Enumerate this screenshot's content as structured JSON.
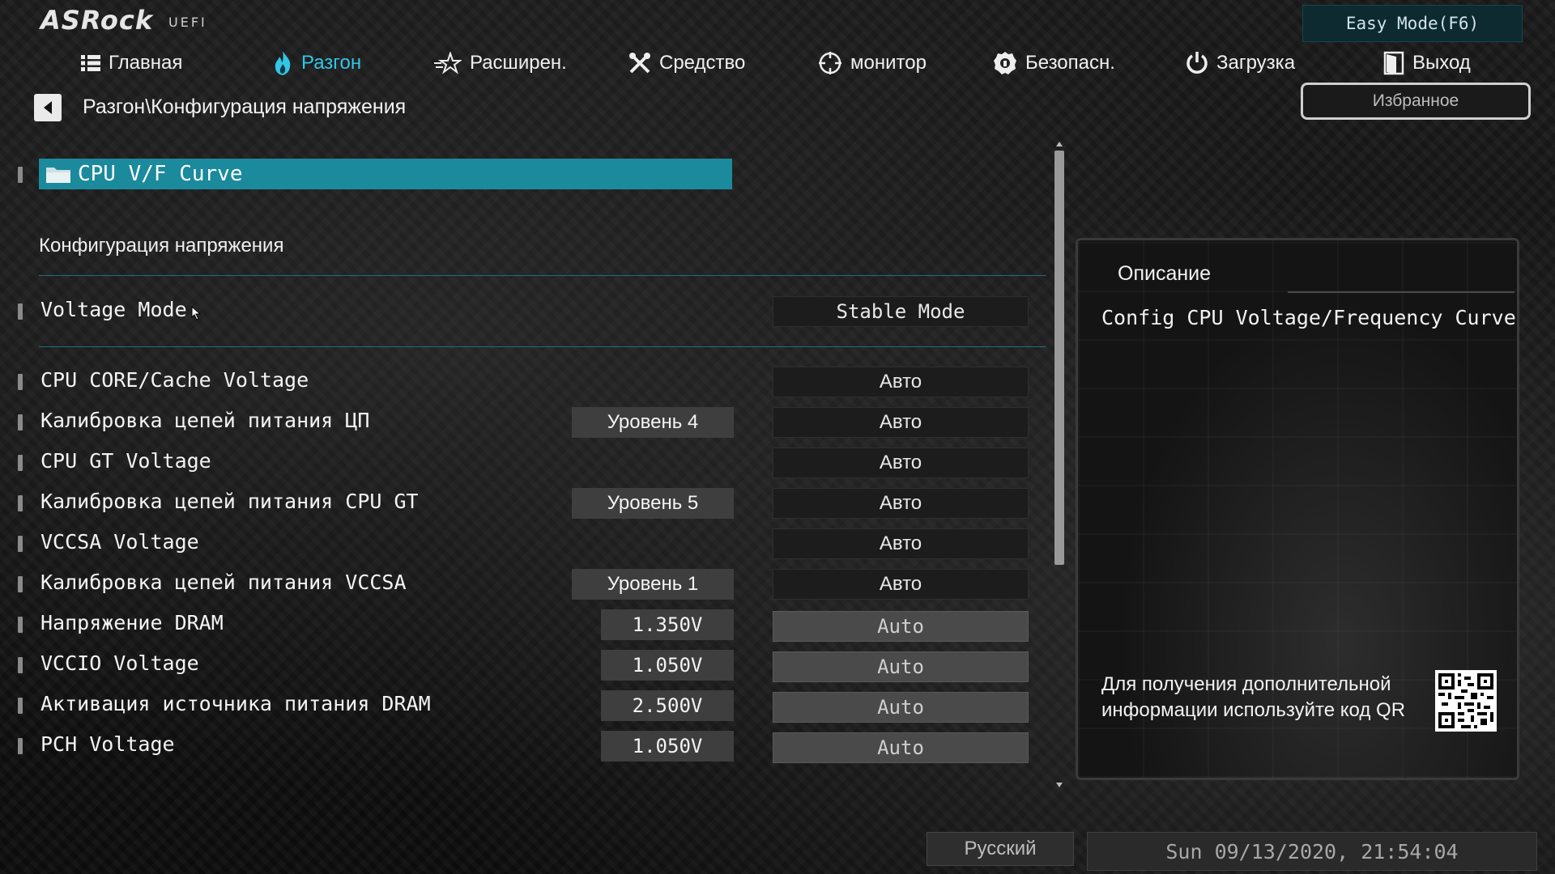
{
  "header": {
    "brand": "ASRock",
    "brand_sub": "UEFI",
    "easy_mode_label": "Easy Mode(F6)",
    "favorites_label": "Избранное"
  },
  "nav": {
    "active": "Разгон",
    "tabs": [
      {
        "label": "Главная",
        "icon": "list-icon"
      },
      {
        "label": "Разгон",
        "icon": "flame-icon"
      },
      {
        "label": "Расширен.",
        "icon": "star-icon"
      },
      {
        "label": "Средство",
        "icon": "tools-icon"
      },
      {
        "label": "монитор",
        "icon": "target-icon"
      },
      {
        "label": "Безопасн.",
        "icon": "shield-icon"
      },
      {
        "label": "Загрузка",
        "icon": "power-icon"
      },
      {
        "label": "Выход",
        "icon": "exit-door-icon"
      }
    ]
  },
  "breadcrumb": "Разгон\\Конфигурация напряжения",
  "main": {
    "folder_item": "CPU V/F Curve",
    "section_title": "Конфигурация напряжения",
    "voltage_mode": {
      "label": "Voltage Mode",
      "value": "Stable Mode"
    },
    "rows": [
      {
        "label": "CPU CORE/Cache Voltage",
        "mid": "",
        "value": "Авто",
        "style": "dark"
      },
      {
        "label": "Калибровка цепей питания ЦП",
        "mid": "Уровень 4",
        "value": "Авто",
        "style": "dark"
      },
      {
        "label": "CPU GT Voltage",
        "mid": "",
        "value": "Авто",
        "style": "dark"
      },
      {
        "label": "Калибровка цепей питания CPU GT",
        "mid": "Уровень 5",
        "value": "Авто",
        "style": "dark"
      },
      {
        "label": "VCCSA Voltage",
        "mid": "",
        "value": "Авто",
        "style": "dark"
      },
      {
        "label": "Калибровка цепей питания VCCSA",
        "mid": "Уровень 1",
        "value": "Авто",
        "style": "dark"
      },
      {
        "label": "Напряжение DRAM",
        "mid": "1.350V",
        "value": "Auto",
        "style": "gray"
      },
      {
        "label": "VCCIO Voltage",
        "mid": "1.050V",
        "value": "Auto",
        "style": "gray"
      },
      {
        "label": "Активация источника питания DRAM",
        "mid": "2.500V",
        "value": "Auto",
        "style": "gray"
      },
      {
        "label": "PCH Voltage",
        "mid": "1.050V",
        "value": "Auto",
        "style": "gray"
      }
    ]
  },
  "description": {
    "title": "Описание",
    "text": "Config CPU Voltage/Frequency Curve",
    "qr_note": "Для получения дополнительной информации используйте код QR"
  },
  "footer": {
    "language": "Русский",
    "datetime": "Sun 09/13/2020, 21:54:04"
  },
  "colors": {
    "accent": "#33c6e6",
    "selected_row": "#1a8a9c",
    "separator": "#1f6e7c"
  }
}
